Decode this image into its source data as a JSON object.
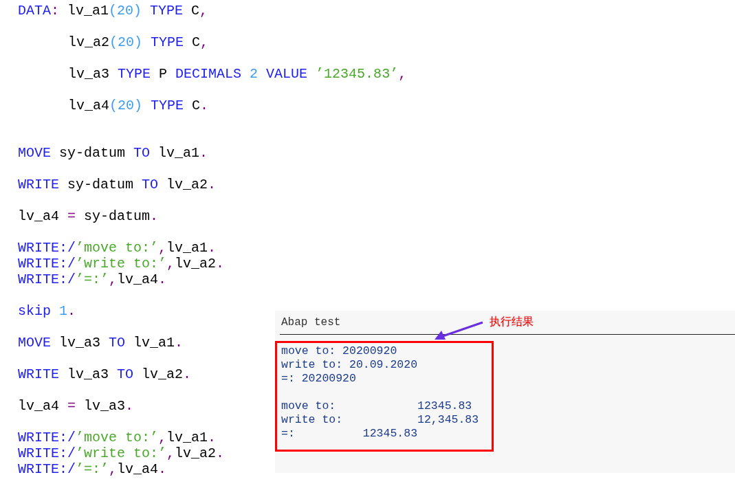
{
  "code_lines": [
    {
      "kind": "code",
      "indent": false,
      "tokens": [
        {
          "kind": "keyword",
          "text": "DATA"
        },
        {
          "kind": "punct",
          "text": ": "
        },
        {
          "kind": "ident",
          "text": "lv_a1"
        },
        {
          "kind": "number",
          "text": "(20) "
        },
        {
          "kind": "keyword",
          "text": "TYPE "
        },
        {
          "kind": "ident",
          "text": "C"
        },
        {
          "kind": "punct",
          "text": ","
        }
      ]
    },
    {
      "kind": "blank"
    },
    {
      "kind": "code",
      "indent": true,
      "tokens": [
        {
          "kind": "ident",
          "text": "lv_a2"
        },
        {
          "kind": "number",
          "text": "(20) "
        },
        {
          "kind": "keyword",
          "text": "TYPE "
        },
        {
          "kind": "ident",
          "text": "C"
        },
        {
          "kind": "punct",
          "text": ","
        }
      ]
    },
    {
      "kind": "blank"
    },
    {
      "kind": "code",
      "indent": true,
      "tokens": [
        {
          "kind": "ident",
          "text": "lv_a3 "
        },
        {
          "kind": "keyword",
          "text": "TYPE "
        },
        {
          "kind": "ident",
          "text": "P "
        },
        {
          "kind": "keyword",
          "text": "DECIMALS "
        },
        {
          "kind": "number",
          "text": "2 "
        },
        {
          "kind": "keyword",
          "text": "VALUE "
        },
        {
          "kind": "string",
          "text": "’12345.83’"
        },
        {
          "kind": "punct",
          "text": ","
        }
      ]
    },
    {
      "kind": "blank"
    },
    {
      "kind": "code",
      "indent": true,
      "tokens": [
        {
          "kind": "ident",
          "text": "lv_a4"
        },
        {
          "kind": "number",
          "text": "(20) "
        },
        {
          "kind": "keyword",
          "text": "TYPE "
        },
        {
          "kind": "ident",
          "text": "C"
        },
        {
          "kind": "punct",
          "text": "."
        }
      ]
    },
    {
      "kind": "blank"
    },
    {
      "kind": "blank"
    },
    {
      "kind": "code",
      "indent": false,
      "tokens": [
        {
          "kind": "keyword",
          "text": "MOVE "
        },
        {
          "kind": "ident",
          "text": "sy-datum "
        },
        {
          "kind": "keyword",
          "text": "TO "
        },
        {
          "kind": "ident",
          "text": "lv_a1"
        },
        {
          "kind": "punct",
          "text": "."
        }
      ]
    },
    {
      "kind": "blank"
    },
    {
      "kind": "code",
      "indent": false,
      "tokens": [
        {
          "kind": "keyword",
          "text": "WRITE "
        },
        {
          "kind": "ident",
          "text": "sy-datum "
        },
        {
          "kind": "keyword",
          "text": "TO "
        },
        {
          "kind": "ident",
          "text": "lv_a2"
        },
        {
          "kind": "punct",
          "text": "."
        }
      ]
    },
    {
      "kind": "blank"
    },
    {
      "kind": "code",
      "indent": false,
      "tokens": [
        {
          "kind": "ident",
          "text": "lv_a4 "
        },
        {
          "kind": "punct",
          "text": "= "
        },
        {
          "kind": "ident",
          "text": "sy-datum"
        },
        {
          "kind": "punct",
          "text": "."
        }
      ]
    },
    {
      "kind": "blank"
    },
    {
      "kind": "code",
      "indent": false,
      "tokens": [
        {
          "kind": "keyword",
          "text": "WRITE:/"
        },
        {
          "kind": "string",
          "text": "’move to:’"
        },
        {
          "kind": "punct",
          "text": ","
        },
        {
          "kind": "ident",
          "text": "lv_a1"
        },
        {
          "kind": "punct",
          "text": "."
        }
      ]
    },
    {
      "kind": "code",
      "indent": false,
      "tokens": [
        {
          "kind": "keyword",
          "text": "WRITE:/"
        },
        {
          "kind": "string",
          "text": "’write to:’"
        },
        {
          "kind": "punct",
          "text": ","
        },
        {
          "kind": "ident",
          "text": "lv_a2"
        },
        {
          "kind": "punct",
          "text": "."
        }
      ]
    },
    {
      "kind": "code",
      "indent": false,
      "tokens": [
        {
          "kind": "keyword",
          "text": "WRITE:/"
        },
        {
          "kind": "string",
          "text": "’=:’"
        },
        {
          "kind": "punct",
          "text": ","
        },
        {
          "kind": "ident",
          "text": "lv_a4"
        },
        {
          "kind": "punct",
          "text": "."
        }
      ]
    },
    {
      "kind": "blank"
    },
    {
      "kind": "code",
      "indent": false,
      "tokens": [
        {
          "kind": "keyword",
          "text": "skip "
        },
        {
          "kind": "number",
          "text": "1"
        },
        {
          "kind": "punct",
          "text": "."
        }
      ]
    },
    {
      "kind": "blank"
    },
    {
      "kind": "code",
      "indent": false,
      "tokens": [
        {
          "kind": "keyword",
          "text": "MOVE "
        },
        {
          "kind": "ident",
          "text": "lv_a3 "
        },
        {
          "kind": "keyword",
          "text": "TO "
        },
        {
          "kind": "ident",
          "text": "lv_a1"
        },
        {
          "kind": "punct",
          "text": "."
        }
      ]
    },
    {
      "kind": "blank"
    },
    {
      "kind": "code",
      "indent": false,
      "tokens": [
        {
          "kind": "keyword",
          "text": "WRITE "
        },
        {
          "kind": "ident",
          "text": "lv_a3 "
        },
        {
          "kind": "keyword",
          "text": "TO "
        },
        {
          "kind": "ident",
          "text": "lv_a2"
        },
        {
          "kind": "punct",
          "text": "."
        }
      ]
    },
    {
      "kind": "blank"
    },
    {
      "kind": "code",
      "indent": false,
      "tokens": [
        {
          "kind": "ident",
          "text": "lv_a4 "
        },
        {
          "kind": "punct",
          "text": "= "
        },
        {
          "kind": "ident",
          "text": "lv_a3"
        },
        {
          "kind": "punct",
          "text": "."
        }
      ]
    },
    {
      "kind": "blank"
    },
    {
      "kind": "code",
      "indent": false,
      "tokens": [
        {
          "kind": "keyword",
          "text": "WRITE:/"
        },
        {
          "kind": "string",
          "text": "’move to:’"
        },
        {
          "kind": "punct",
          "text": ","
        },
        {
          "kind": "ident",
          "text": "lv_a1"
        },
        {
          "kind": "punct",
          "text": "."
        }
      ]
    },
    {
      "kind": "code",
      "indent": false,
      "tokens": [
        {
          "kind": "keyword",
          "text": "WRITE:/"
        },
        {
          "kind": "string",
          "text": "’write to:’"
        },
        {
          "kind": "punct",
          "text": ","
        },
        {
          "kind": "ident",
          "text": "lv_a2"
        },
        {
          "kind": "punct",
          "text": "."
        }
      ]
    },
    {
      "kind": "code",
      "indent": false,
      "tokens": [
        {
          "kind": "keyword",
          "text": "WRITE:/"
        },
        {
          "kind": "string",
          "text": "’=:’"
        },
        {
          "kind": "punct",
          "text": ","
        },
        {
          "kind": "ident",
          "text": "lv_a4"
        },
        {
          "kind": "punct",
          "text": "."
        }
      ]
    }
  ],
  "output_window": {
    "title": "Abap test",
    "annotation": "执行结果",
    "lines": [
      {
        "kind": "text",
        "text": "move to: 20200920"
      },
      {
        "kind": "text",
        "text": "write to: 20.09.2020"
      },
      {
        "kind": "text",
        "text": "=: 20200920"
      },
      {
        "kind": "blank"
      },
      {
        "kind": "text",
        "text": "move to:            12345.83"
      },
      {
        "kind": "text",
        "text": "write to:           12,345.83"
      },
      {
        "kind": "text",
        "text": "=:          12345.83"
      }
    ]
  }
}
